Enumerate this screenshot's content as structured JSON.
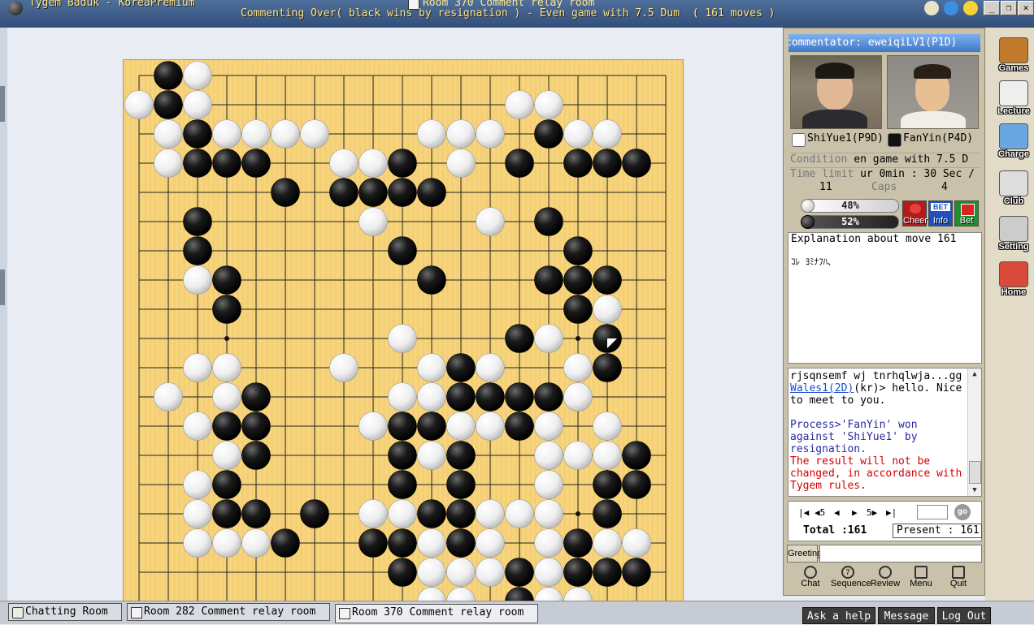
{
  "window": {
    "app_title": "Tygem Baduk - KoreaPremium",
    "room_title": "Room 370 Comment relay room",
    "game_status": "Commenting Over( black wins by resignation ) - Even game with 7.5 Dum  ( 161 moves )",
    "title_icons": [
      "pencil-icon",
      "search-icon",
      "lightbulb-icon"
    ],
    "window_buttons": [
      "_",
      "❐",
      "✕"
    ]
  },
  "board": {
    "size": 19,
    "hoshi": [
      [
        3,
        3
      ],
      [
        3,
        9
      ],
      [
        3,
        15
      ],
      [
        9,
        3
      ],
      [
        9,
        9
      ],
      [
        9,
        15
      ],
      [
        15,
        3
      ],
      [
        15,
        9
      ],
      [
        15,
        15
      ]
    ],
    "last_move": [
      16,
      9
    ],
    "black": [
      [
        1,
        0
      ],
      [
        1,
        1
      ],
      [
        2,
        2
      ],
      [
        2,
        3
      ],
      [
        3,
        3
      ],
      [
        4,
        3
      ],
      [
        5,
        4
      ],
      [
        14,
        2
      ],
      [
        13,
        3
      ],
      [
        15,
        3
      ],
      [
        16,
        3
      ],
      [
        17,
        3
      ],
      [
        9,
        3
      ],
      [
        7,
        4
      ],
      [
        8,
        4
      ],
      [
        9,
        4
      ],
      [
        10,
        4
      ],
      [
        2,
        5
      ],
      [
        2,
        6
      ],
      [
        3,
        7
      ],
      [
        3,
        8
      ],
      [
        9,
        6
      ],
      [
        10,
        7
      ],
      [
        14,
        5
      ],
      [
        15,
        6
      ],
      [
        14,
        7
      ],
      [
        15,
        7
      ],
      [
        16,
        7
      ],
      [
        15,
        8
      ],
      [
        13,
        9
      ],
      [
        16,
        9
      ],
      [
        11,
        10
      ],
      [
        16,
        10
      ],
      [
        4,
        11
      ],
      [
        11,
        11
      ],
      [
        12,
        11
      ],
      [
        13,
        11
      ],
      [
        14,
        11
      ],
      [
        3,
        12
      ],
      [
        4,
        12
      ],
      [
        9,
        12
      ],
      [
        10,
        12
      ],
      [
        13,
        12
      ],
      [
        4,
        13
      ],
      [
        9,
        13
      ],
      [
        11,
        13
      ],
      [
        17,
        13
      ],
      [
        3,
        14
      ],
      [
        9,
        14
      ],
      [
        11,
        14
      ],
      [
        16,
        14
      ],
      [
        17,
        14
      ],
      [
        3,
        15
      ],
      [
        4,
        15
      ],
      [
        6,
        15
      ],
      [
        10,
        15
      ],
      [
        11,
        15
      ],
      [
        16,
        15
      ],
      [
        5,
        16
      ],
      [
        8,
        16
      ],
      [
        9,
        16
      ],
      [
        11,
        16
      ],
      [
        15,
        16
      ],
      [
        9,
        17
      ],
      [
        13,
        17
      ],
      [
        15,
        17
      ],
      [
        16,
        17
      ],
      [
        17,
        17
      ],
      [
        13,
        18
      ]
    ],
    "white": [
      [
        2,
        0
      ],
      [
        0,
        1
      ],
      [
        2,
        1
      ],
      [
        1,
        2
      ],
      [
        3,
        2
      ],
      [
        4,
        2
      ],
      [
        5,
        2
      ],
      [
        6,
        2
      ],
      [
        10,
        2
      ],
      [
        11,
        2
      ],
      [
        12,
        2
      ],
      [
        15,
        2
      ],
      [
        16,
        2
      ],
      [
        1,
        3
      ],
      [
        7,
        3
      ],
      [
        8,
        3
      ],
      [
        9,
        3
      ],
      [
        11,
        3
      ],
      [
        15,
        3
      ],
      [
        8,
        4
      ],
      [
        13,
        1
      ],
      [
        14,
        1
      ],
      [
        8,
        5
      ],
      [
        12,
        5
      ],
      [
        2,
        7
      ],
      [
        3,
        8
      ],
      [
        15,
        8
      ],
      [
        9,
        9
      ],
      [
        14,
        9
      ],
      [
        16,
        8
      ],
      [
        10,
        10
      ],
      [
        15,
        10
      ],
      [
        2,
        10
      ],
      [
        3,
        10
      ],
      [
        7,
        10
      ],
      [
        12,
        10
      ],
      [
        15,
        10
      ],
      [
        1,
        11
      ],
      [
        3,
        11
      ],
      [
        9,
        11
      ],
      [
        10,
        11
      ],
      [
        15,
        11
      ],
      [
        2,
        12
      ],
      [
        8,
        12
      ],
      [
        11,
        12
      ],
      [
        12,
        12
      ],
      [
        14,
        12
      ],
      [
        16,
        12
      ],
      [
        3,
        13
      ],
      [
        10,
        13
      ],
      [
        14,
        13
      ],
      [
        15,
        13
      ],
      [
        16,
        13
      ],
      [
        2,
        14
      ],
      [
        14,
        14
      ],
      [
        2,
        15
      ],
      [
        8,
        15
      ],
      [
        9,
        15
      ],
      [
        12,
        15
      ],
      [
        13,
        15
      ],
      [
        14,
        15
      ],
      [
        2,
        16
      ],
      [
        3,
        16
      ],
      [
        4,
        16
      ],
      [
        10,
        16
      ],
      [
        12,
        16
      ],
      [
        14,
        16
      ],
      [
        16,
        16
      ],
      [
        17,
        16
      ],
      [
        10,
        17
      ],
      [
        11,
        17
      ],
      [
        12,
        17
      ],
      [
        14,
        17
      ],
      [
        10,
        18
      ],
      [
        11,
        18
      ],
      [
        14,
        18
      ],
      [
        15,
        18
      ]
    ]
  },
  "panel": {
    "commentator": "commentator: eweiqiLV1(P1D)",
    "white_player": "ShiYue1(P9D)",
    "black_player": "FanYin(P4D)",
    "condition_label": "Condition",
    "condition_value": " en game with 7.5 D",
    "time_label": "Time limit",
    "time_value": " ur 0min : 30 Sec /",
    "caps_white": "11",
    "caps_label": "Caps",
    "caps_black": "4",
    "white_pct": "48%",
    "black_pct": "52%",
    "white_pct_value": 48,
    "black_pct_value": 52,
    "buttons": {
      "cheer": "Cheer",
      "info": "Info",
      "bet": "Bet",
      "bet_badge": "BET"
    },
    "explanation_title": "Explanation about move 161",
    "explanation_text": "ｺﾚ ﾖﾐﾅﾌﾊ､"
  },
  "chat": {
    "line1": "rjsqnsemf wj tnrhqlwja...gg",
    "user": "Wales1(2D)",
    "msg": "(kr)> hello. Nice to meet to you.",
    "process": "Process>'FanYin' won against 'ShiYue1' by resignation.",
    "notice": "The result will not be changed, in accordance with Tygem rules."
  },
  "nav": {
    "buttons": [
      "|◀",
      "◀5",
      "◀",
      "▶",
      "5▶",
      "▶|"
    ],
    "move_value": "",
    "go": "go",
    "total": "Total :161",
    "present": "Present : 161"
  },
  "actions": {
    "greeting": "Greeting",
    "chat": "Chat",
    "sequence": "Sequence",
    "review": "Review",
    "menu": "Menu",
    "quit": "Quit"
  },
  "side_nav": [
    "Games",
    "Lecture",
    "Charge",
    "Club",
    "Setting",
    "Home"
  ],
  "taskbar": {
    "tabs": [
      "Chatting Room",
      "Room 282 Comment relay room",
      "Room 370 Comment relay room"
    ],
    "help": "Ask a help",
    "message": "Message",
    "logout": "Log Out"
  },
  "colors": {
    "board": "#f5d27a",
    "title_bg": "#3b5a87",
    "title_text": "#ffe58c",
    "commentator_bg": "#5a93dd",
    "cheer": "#c41818",
    "info": "#1f4fc0",
    "bet": "#1e8f2e"
  }
}
